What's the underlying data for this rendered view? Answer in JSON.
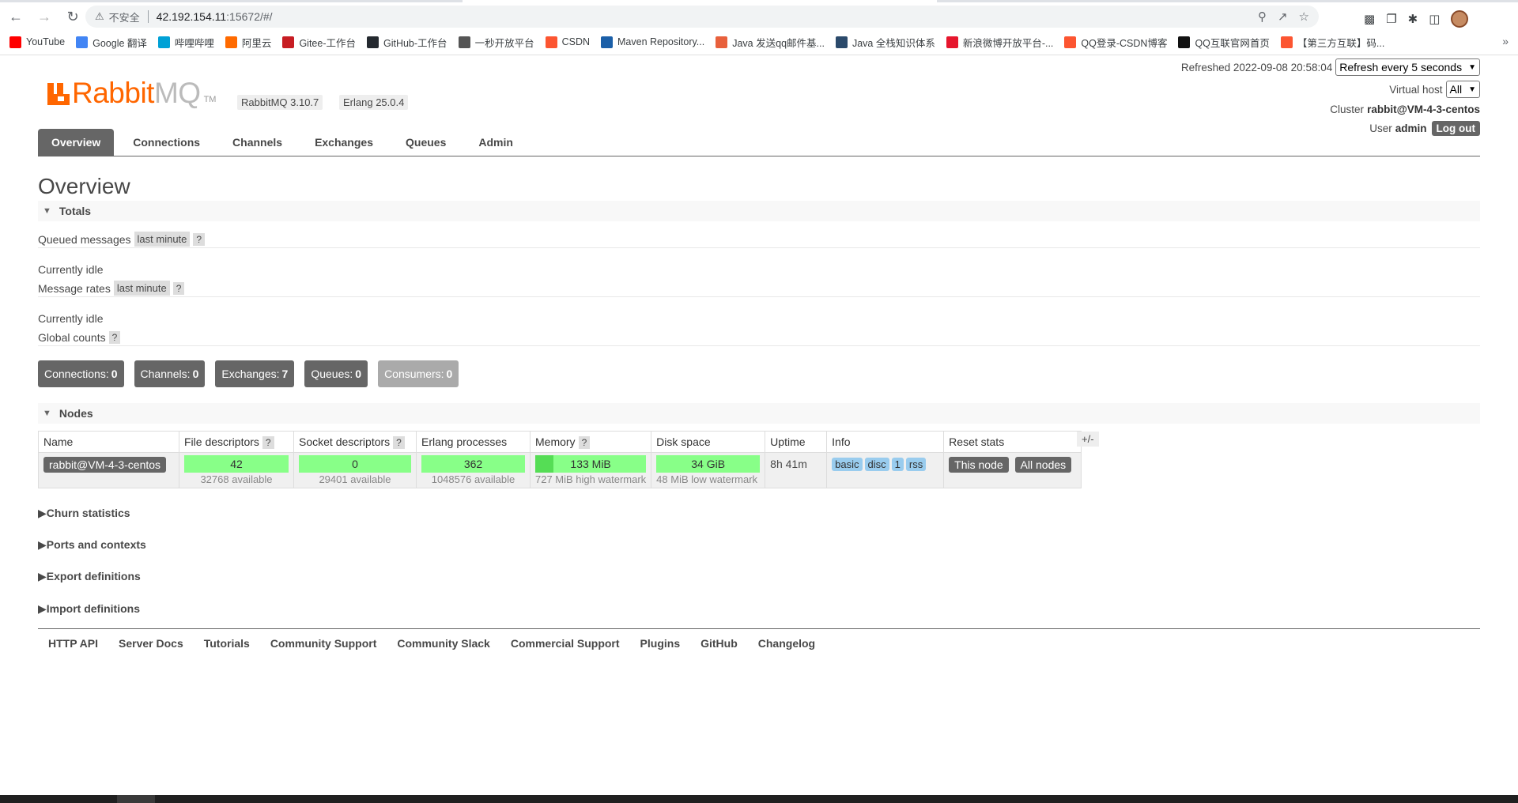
{
  "browser": {
    "insecure_label": "不安全",
    "url_host": "42.192.154.11",
    "url_rest": ":15672/#/",
    "bookmarks": [
      {
        "label": "YouTube",
        "color": "#ff0000"
      },
      {
        "label": "Google 翻译",
        "color": "#4285f4"
      },
      {
        "label": "哔哩哔哩",
        "color": "#00a1d6"
      },
      {
        "label": "阿里云",
        "color": "#ff6a00"
      },
      {
        "label": "Gitee-工作台",
        "color": "#c71d23"
      },
      {
        "label": "GitHub-工作台",
        "color": "#24292f"
      },
      {
        "label": "一秒开放平台",
        "color": "#555555"
      },
      {
        "label": "CSDN",
        "color": "#fc5531"
      },
      {
        "label": "Maven Repository...",
        "color": "#1b5fa8"
      },
      {
        "label": "Java 发送qq邮件基...",
        "color": "#e8603c"
      },
      {
        "label": "Java 全栈知识体系",
        "color": "#2b4a6b"
      },
      {
        "label": "新浪微博开放平台-...",
        "color": "#e6162d"
      },
      {
        "label": "QQ登录-CSDN博客",
        "color": "#fc5531"
      },
      {
        "label": "QQ互联官网首页",
        "color": "#111111"
      },
      {
        "label": "【第三方互联】码...",
        "color": "#fc5531"
      }
    ]
  },
  "header": {
    "logo_rabbit": "Rabbit",
    "logo_mq": "MQ",
    "logo_tm": "TM",
    "version_rabbitmq": "RabbitMQ 3.10.7",
    "version_erlang": "Erlang 25.0.4",
    "refreshed_label": "Refreshed 2022-09-08 20:58:04",
    "refresh_select": "Refresh every 5 seconds",
    "vhost_label": "Virtual host",
    "vhost_select": "All",
    "cluster_label": "Cluster",
    "cluster_name": "rabbit@VM-4-3-centos",
    "user_label": "User",
    "user_name": "admin",
    "logout": "Log out"
  },
  "nav": {
    "tabs": [
      "Overview",
      "Connections",
      "Channels",
      "Exchanges",
      "Queues",
      "Admin"
    ]
  },
  "overview": {
    "title": "Overview",
    "totals_heading": "Totals",
    "queued_messages_label": "Queued messages",
    "queued_range": "last minute",
    "help": "?",
    "currently_idle_1": "Currently idle",
    "message_rates_label": "Message rates",
    "rates_range": "last minute",
    "currently_idle_2": "Currently idle",
    "global_counts_label": "Global counts",
    "counts": [
      {
        "label": "Connections:",
        "value": "0"
      },
      {
        "label": "Channels:",
        "value": "0"
      },
      {
        "label": "Exchanges:",
        "value": "7"
      },
      {
        "label": "Queues:",
        "value": "0"
      },
      {
        "label": "Consumers:",
        "value": "0"
      }
    ]
  },
  "nodes": {
    "heading": "Nodes",
    "columns": [
      "Name",
      "File descriptors",
      "Socket descriptors",
      "Erlang processes",
      "Memory",
      "Disk space",
      "Uptime",
      "Info",
      "Reset stats"
    ],
    "plus_minus": "+/-",
    "row": {
      "name": "rabbit@VM-4-3-centos",
      "fd_used": "42",
      "fd_avail": "32768 available",
      "sd_used": "0",
      "sd_avail": "29401 available",
      "ep_used": "362",
      "ep_avail": "1048576 available",
      "mem_used": "133 MiB",
      "mem_note": "727 MiB high watermark",
      "disk_used": "34 GiB",
      "disk_note": "48 MiB low watermark",
      "uptime": "8h 41m",
      "info_tags": [
        "basic",
        "disc",
        "1",
        "rss"
      ],
      "reset_this": "This node",
      "reset_all": "All nodes"
    }
  },
  "sections": {
    "churn": "Churn statistics",
    "ports": "Ports and contexts",
    "export": "Export definitions",
    "import": "Import definitions"
  },
  "footer": {
    "links": [
      "HTTP API",
      "Server Docs",
      "Tutorials",
      "Community Support",
      "Community Slack",
      "Commercial Support",
      "Plugins",
      "GitHub",
      "Changelog"
    ]
  }
}
